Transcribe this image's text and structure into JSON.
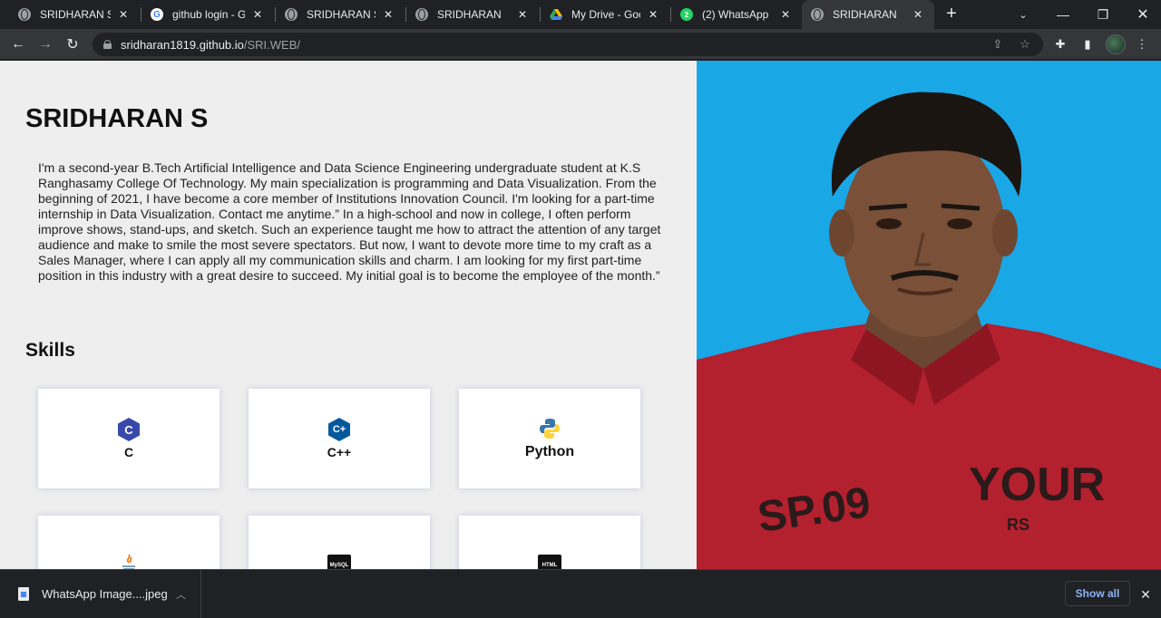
{
  "browser": {
    "tabs": [
      {
        "title": "SRIDHARAN S",
        "icon": "globe-icon"
      },
      {
        "title": "github login - Go",
        "icon": "google-icon"
      },
      {
        "title": "SRIDHARAN S(RE",
        "icon": "globe-icon"
      },
      {
        "title": "SRIDHARAN",
        "icon": "globe-icon"
      },
      {
        "title": "My Drive - Googl",
        "icon": "google-drive-icon"
      },
      {
        "title": "(2) WhatsApp",
        "icon": "whatsapp-icon",
        "badge": "2"
      },
      {
        "title": "SRIDHARAN",
        "icon": "globe-icon",
        "active": true
      }
    ],
    "url_host": "sridharan1819.github.io",
    "url_path": "/SRI.WEB/",
    "toolbar_icons": [
      "back-icon",
      "forward-icon",
      "reload-icon",
      "share-icon",
      "bookmark-star-icon",
      "extensions-icon",
      "side-panel-icon",
      "profile-avatar",
      "menu-icon"
    ]
  },
  "page": {
    "name": "SRIDHARAN S",
    "about": "I'm a second-year B.Tech Artificial Intelligence and Data Science Engineering undergraduate student at K.S Ranghasamy College Of Technology. My main specialization is programming and Data Visualization. From the beginning of 2021, I have become a core member of Institutions Innovation Council. I'm looking for a part-time internship in Data Visualization. Contact me anytime.” In a high-school and now in college, I often perform improve shows, stand-ups, and sketch. Such an experience taught me how to attract the attention of any target audience and make to smile the most severe spectators. But now, I want to devote more time to my craft as a Sales Manager, where I can apply all my communication skills and charm. I am looking for my first part-time position in this industry with a great desire to succeed. My initial goal is to become the employee of the month.”",
    "skills_title": "Skills",
    "skills": [
      {
        "label": "C",
        "icon": "c-language-icon"
      },
      {
        "label": "C++",
        "icon": "cpp-language-icon"
      },
      {
        "label": "Python",
        "icon": "python-icon"
      },
      {
        "label": "",
        "icon": "java-icon"
      },
      {
        "label": "",
        "icon": "mysql-icon",
        "icon_text": "MySQL"
      },
      {
        "label": "",
        "icon": "html-icon",
        "icon_text": "HTML"
      }
    ],
    "photo_shirt_text_1": "SP.09",
    "photo_shirt_text_2": "YOUR",
    "photo_shirt_text_3": "RS",
    "photo_bg_color": "#1aa7e6"
  },
  "downloads": {
    "file_name": "WhatsApp Image....jpeg",
    "show_all": "Show all"
  }
}
